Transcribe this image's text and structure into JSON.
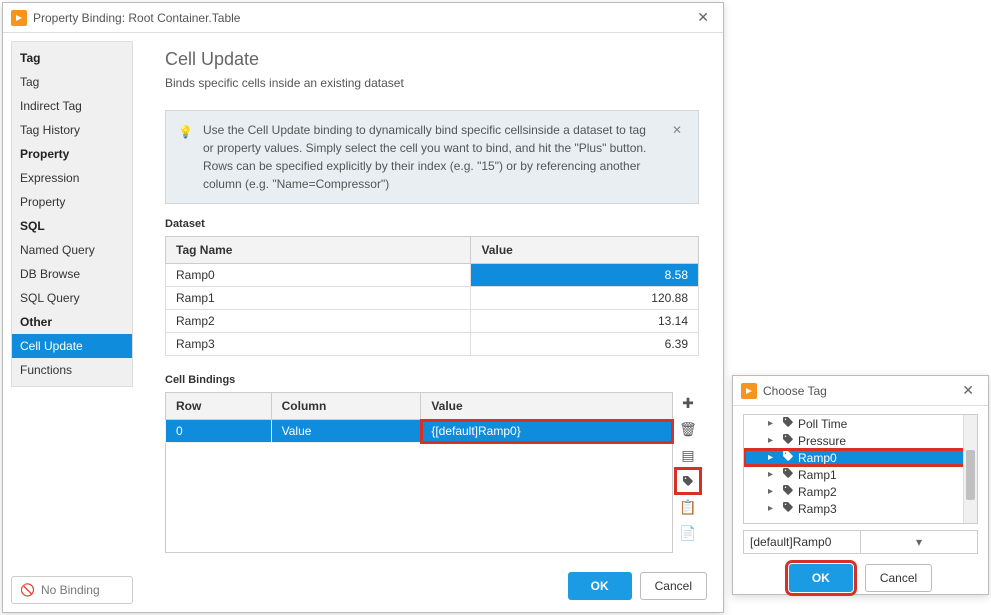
{
  "main_window": {
    "title": "Property Binding: Root Container.Table",
    "sidebar": {
      "groups": [
        {
          "header": "Tag",
          "items": [
            "Tag",
            "Indirect Tag",
            "Tag History"
          ]
        },
        {
          "header": "Property",
          "items": [
            "Expression",
            "Property"
          ]
        },
        {
          "header": "SQL",
          "items": [
            "Named Query",
            "DB Browse",
            "SQL Query"
          ]
        },
        {
          "header": "Other",
          "items": [
            "Cell Update",
            "Functions"
          ]
        }
      ],
      "selected": "Cell Update",
      "no_binding_label": "No Binding"
    },
    "heading": "Cell Update",
    "subheading": "Binds specific cells inside an existing dataset",
    "tip_text": "Use the Cell Update binding to dynamically bind specific cellsinside a dataset to tag or property values. Simply select the cell you want to bind, and hit the \"Plus\" button. Rows can be specified explicitly by their index (e.g. \"15\") or by referencing another column (e.g. \"Name=Compressor\")",
    "dataset_label": "Dataset",
    "dataset_columns": [
      "Tag Name",
      "Value"
    ],
    "dataset_rows": [
      {
        "tag": "Ramp0",
        "value": "8.58",
        "selected": true
      },
      {
        "tag": "Ramp1",
        "value": "120.88",
        "selected": false
      },
      {
        "tag": "Ramp2",
        "value": "13.14",
        "selected": false
      },
      {
        "tag": "Ramp3",
        "value": "6.39",
        "selected": false
      }
    ],
    "bindings_label": "Cell Bindings",
    "bindings_columns": [
      "Row",
      "Column",
      "Value"
    ],
    "bindings_rows": [
      {
        "row": "0",
        "column": "Value",
        "value": "{[default]Ramp0}"
      }
    ],
    "buttons": {
      "ok": "OK",
      "cancel": "Cancel"
    }
  },
  "choose_window": {
    "title": "Choose Tag",
    "tree": [
      "Poll Time",
      "Pressure",
      "Ramp0",
      "Ramp1",
      "Ramp2",
      "Ramp3"
    ],
    "tree_selected": "Ramp0",
    "path": "[default]Ramp0",
    "buttons": {
      "ok": "OK",
      "cancel": "Cancel"
    }
  }
}
